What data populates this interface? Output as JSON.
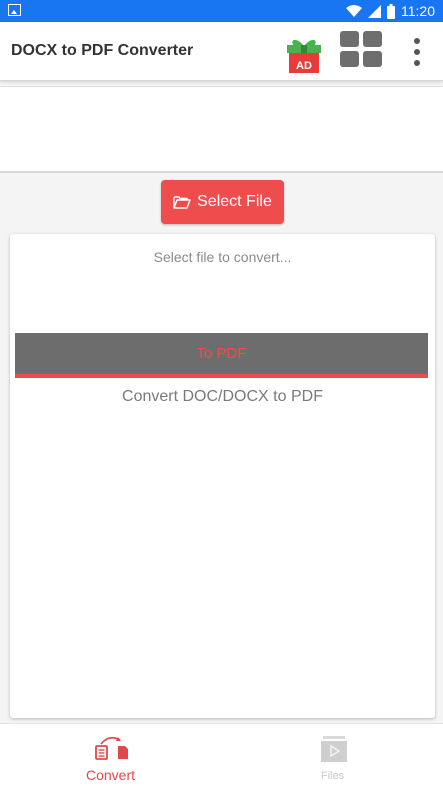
{
  "status_bar": {
    "time": "11:20",
    "icons": [
      "image-icon",
      "wifi-icon",
      "signal-icon",
      "battery-icon"
    ]
  },
  "app_bar": {
    "title": "DOCX to PDF Converter",
    "ad_badge": "AD",
    "icons": [
      "gift-ad-icon",
      "grid-apps-icon",
      "more-vert-icon"
    ]
  },
  "select_button": {
    "label": "Select File",
    "icon": "folder-open-icon"
  },
  "card": {
    "hint": "Select file to convert...",
    "to_pdf_label": "To PDF",
    "description": "Convert DOC/DOCX to PDF"
  },
  "bottom_nav": {
    "items": [
      {
        "label": "Convert",
        "icon": "convert-icon",
        "active": true
      },
      {
        "label": "Files",
        "icon": "files-icon",
        "active": false
      }
    ]
  },
  "colors": {
    "status_bar": "#1976f2",
    "accent": "#ef4d4d",
    "to_pdf_background": "#6d6d6d",
    "inactive": "#c9c9c9"
  }
}
